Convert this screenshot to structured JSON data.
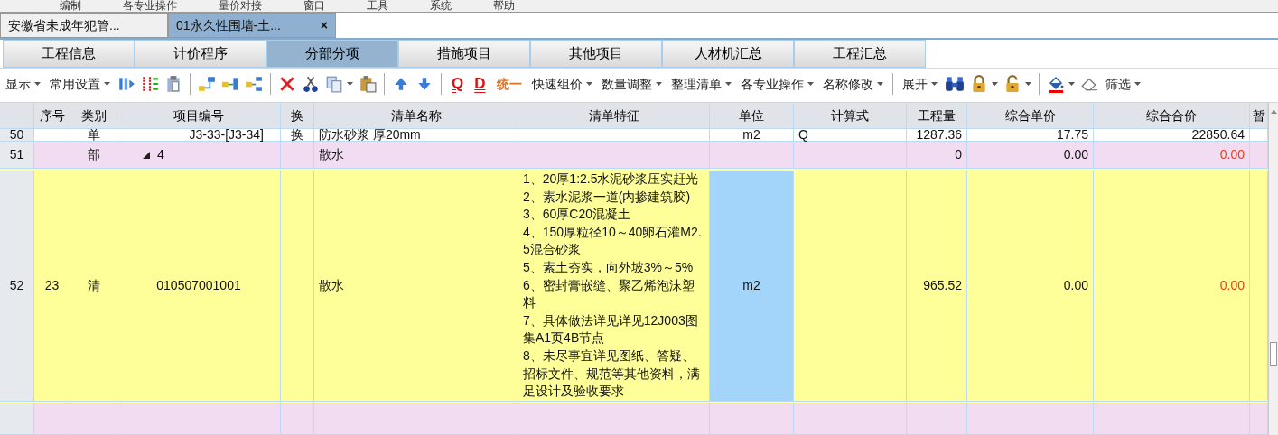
{
  "menu": [
    "编制",
    "各专业操作",
    "量价对接",
    "窗口",
    "工具",
    "系统",
    "帮助"
  ],
  "doc_tabs": [
    {
      "label": "安徽省未成年犯管...",
      "selected": false
    },
    {
      "label": "01永久性围墙-土...",
      "selected": true,
      "close": "×"
    }
  ],
  "module_tabs": [
    {
      "label": "工程信息",
      "selected": false
    },
    {
      "label": "计价程序",
      "selected": false
    },
    {
      "label": "分部分项",
      "selected": true
    },
    {
      "label": "措施项目",
      "selected": false
    },
    {
      "label": "其他项目",
      "selected": false
    },
    {
      "label": "人材机汇总",
      "selected": false
    },
    {
      "label": "工程汇总",
      "selected": false
    }
  ],
  "toolbar": [
    {
      "kind": "menu",
      "label": "显示"
    },
    {
      "kind": "menu",
      "label": "常用设置"
    },
    {
      "kind": "icon"
    },
    {
      "kind": "icon"
    },
    {
      "kind": "icon"
    },
    {
      "kind": "sep"
    },
    {
      "kind": "icon"
    },
    {
      "kind": "icon"
    },
    {
      "kind": "icon"
    },
    {
      "kind": "sep"
    },
    {
      "kind": "icon"
    },
    {
      "kind": "icon"
    },
    {
      "kind": "icon-menu"
    },
    {
      "kind": "icon"
    },
    {
      "kind": "sep"
    },
    {
      "kind": "icon"
    },
    {
      "kind": "icon"
    },
    {
      "kind": "sep"
    },
    {
      "kind": "text-icon",
      "label": "Q"
    },
    {
      "kind": "text-icon",
      "label": "D"
    },
    {
      "kind": "text-icon",
      "label": "统一"
    },
    {
      "kind": "menu",
      "label": "快速组价"
    },
    {
      "kind": "menu",
      "label": "数量调整"
    },
    {
      "kind": "menu",
      "label": "整理清单"
    },
    {
      "kind": "menu",
      "label": "各专业操作"
    },
    {
      "kind": "menu",
      "label": "名称修改"
    },
    {
      "kind": "sep"
    },
    {
      "kind": "menu",
      "label": "展开"
    },
    {
      "kind": "icon"
    },
    {
      "kind": "icon-menu"
    },
    {
      "kind": "icon-menu"
    },
    {
      "kind": "sep"
    },
    {
      "kind": "icon-menu"
    },
    {
      "kind": "icon"
    },
    {
      "kind": "menu",
      "label": "筛选"
    }
  ],
  "table": {
    "columns": [
      "序号",
      "类别",
      "项目编号",
      "换",
      "清单名称",
      "清单特征",
      "单位",
      "计算式",
      "工程量",
      "综合单价",
      "综合合价",
      "暂"
    ],
    "rows": [
      {
        "kind": "quota",
        "row_no": "50",
        "seq": "",
        "type": "单",
        "code": "J3-33-[J3-34]",
        "swap": "换",
        "name": "防水砂浆 厚20mm",
        "features": "",
        "unit": "m2",
        "formula": "Q",
        "qty": "1287.36",
        "unit_price": "17.75",
        "total": "22850.64",
        "total_alert": false,
        "unit_selected": false
      },
      {
        "kind": "section",
        "row_no": "51",
        "seq": "",
        "type": "部",
        "code": "4",
        "expanded": true,
        "swap": "",
        "name": "散水",
        "features": "",
        "unit": "",
        "formula": "",
        "qty": "0",
        "unit_price": "0.00",
        "total": "0.00",
        "total_alert": true,
        "unit_selected": false
      },
      {
        "kind": "item",
        "row_no": "52",
        "seq": "23",
        "type": "清",
        "code": "010507001001",
        "swap": "",
        "name": "散水",
        "features": "1、20厚1:2.5水泥砂浆压实赶光\n2、素水泥浆一道(内掺建筑胶)\n3、60厚C20混凝土\n4、150厚粒径10～40卵石灌M2.5混合砂浆\n5、素土夯实，向外坡3%～5%\n6、密封膏嵌缝、聚乙烯泡沫塑料\n7、具体做法详见详见12J003图集A1页4B节点\n8、未尽事宜详见图纸、答疑、招标文件、规范等其他资料，满足设计及验收要求",
        "unit": "m2",
        "formula": "",
        "qty": "965.52",
        "unit_price": "0.00",
        "total": "0.00",
        "total_alert": true,
        "unit_selected": true
      },
      {
        "kind": "section"
      }
    ]
  }
}
